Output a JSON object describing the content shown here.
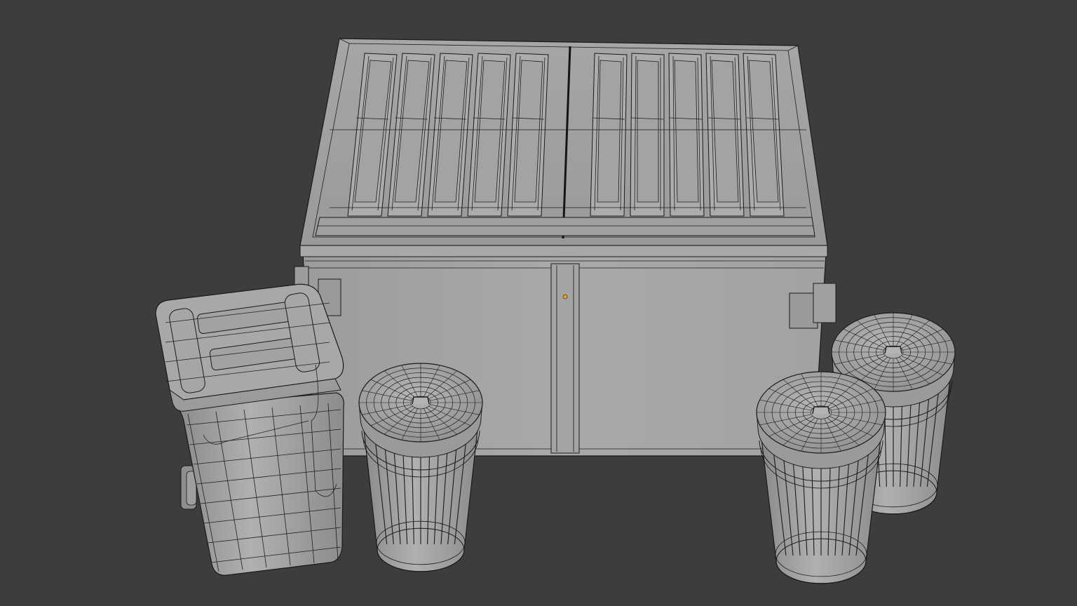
{
  "viewport": {
    "background": "#3d3d3d",
    "mode": "wireframe-overlay"
  },
  "scene": {
    "objects": [
      {
        "name": "dumpster",
        "lid_panels_per_side": 5
      },
      {
        "name": "wheelie-bin"
      },
      {
        "name": "trash-can"
      },
      {
        "name": "trash-can"
      },
      {
        "name": "trash-can"
      }
    ],
    "origin_marker_color": "#e8a030",
    "mesh_color": "#a8a8a8",
    "wire_color": "#1e1e1e"
  }
}
